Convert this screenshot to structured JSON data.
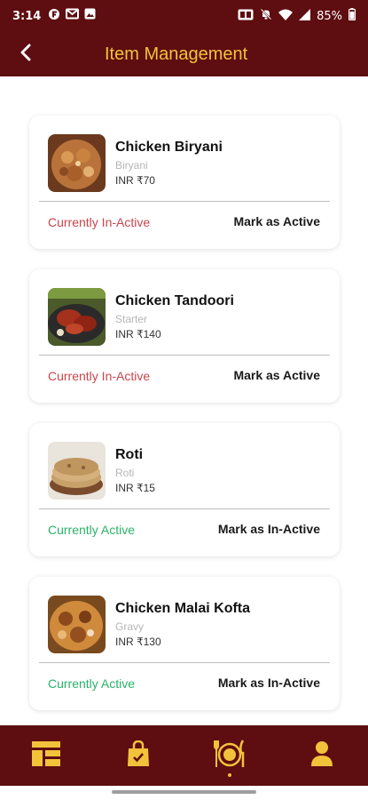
{
  "status_bar": {
    "time": "3:14",
    "battery": "85%"
  },
  "header": {
    "title": "Item Management"
  },
  "items": [
    {
      "name": "Chicken Biryani",
      "category": "Biryani",
      "price": "INR ₹70",
      "status": "Currently In-Active",
      "action": "Mark as Active"
    },
    {
      "name": "Chicken Tandoori",
      "category": "Starter",
      "price": "INR ₹140",
      "status": "Currently In-Active",
      "action": "Mark as Active"
    },
    {
      "name": "Roti",
      "category": "Roti",
      "price": "INR ₹15",
      "status": "Currently Active",
      "action": "Mark as In-Active"
    },
    {
      "name": "Chicken Malai Kofta",
      "category": "Gravy",
      "price": "INR ₹130",
      "status": "Currently Active",
      "action": "Mark as In-Active"
    }
  ],
  "bottom_nav": [
    {
      "icon": "dashboard-icon"
    },
    {
      "icon": "shopping-bag-icon"
    },
    {
      "icon": "dining-icon",
      "selected": true
    },
    {
      "icon": "profile-icon"
    }
  ],
  "colors": {
    "brand_maroon": "#5e0d10",
    "accent_gold": "#f2c23a",
    "inactive_red": "#c8454d",
    "active_green": "#2bb26a"
  }
}
